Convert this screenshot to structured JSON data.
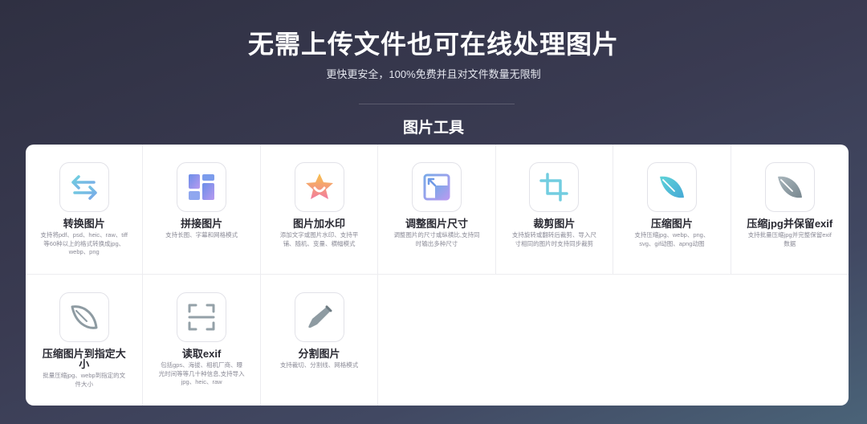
{
  "hero": {
    "title": "无需上传文件也可在线处理图片",
    "subtitle": "更快更安全，100%免费并且对文件数量无限制"
  },
  "section": {
    "title": "图片工具"
  },
  "tools": [
    {
      "name": "转换图片",
      "desc": "支持将pdf、psd、heic、raw、tiff等60种以上的格式转换成jpg、webp、png",
      "icon": "convert-arrows-icon"
    },
    {
      "name": "拼接图片",
      "desc": "支持长图、字幕和网格模式",
      "icon": "collage-grid-icon"
    },
    {
      "name": "图片加水印",
      "desc": "添加文字或图片水印、支持平铺、随机、变量、横幅模式",
      "icon": "watermark-star-icon"
    },
    {
      "name": "调整图片尺寸",
      "desc": "调整图片的尺寸或纵横比,支持同时输出多种尺寸",
      "icon": "resize-frame-icon"
    },
    {
      "name": "裁剪图片",
      "desc": "支持旋转或翻转后裁剪、导入尺寸相同的图片时支持同步裁剪",
      "icon": "crop-icon"
    },
    {
      "name": "压缩图片",
      "desc": "支持压缩jpg、webp、png、svg、gif动图、apng动图",
      "icon": "feather-teal-icon"
    },
    {
      "name": "压缩jpg并保留exif",
      "desc": "支持批量压缩jpg并完整保留exif数据",
      "icon": "feather-gray-icon"
    },
    {
      "name": "压缩图片到指定大小",
      "desc": "批量压缩jpg、webp到指定的文件大小",
      "icon": "feather-outline-icon"
    },
    {
      "name": "读取exif",
      "desc": "包括gps、海拔、相机厂商、曝光时间等等几十种信息,支持导入jpg、heic、raw",
      "icon": "scan-frame-icon"
    },
    {
      "name": "分割图片",
      "desc": "支持裁切、分割线、网格模式",
      "icon": "knife-icon"
    }
  ]
}
